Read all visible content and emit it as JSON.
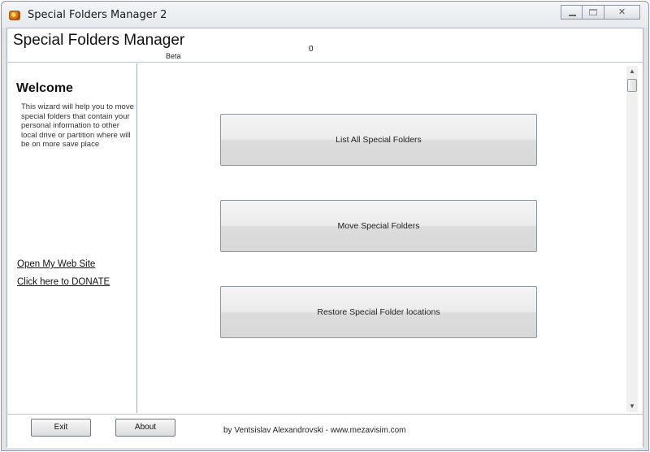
{
  "window": {
    "title": "Special Folders Manager 2",
    "controls": {
      "minimize": "minimize",
      "maximize": "maximize",
      "close": "✕"
    }
  },
  "header": {
    "title": "Special Folders Manager",
    "beta": "Beta",
    "counter": "0"
  },
  "sidebar": {
    "welcome": "Welcome",
    "intro": "This wizard will help you to move special folders that contain your personal information to other local drive or partition where will be on more save place",
    "link_website": "Open My Web Site",
    "link_donate": "Click here to DONATE"
  },
  "main": {
    "buttons": [
      {
        "label": "List All Special Folders"
      },
      {
        "label": "Move Special Folders"
      },
      {
        "label": "Restore Special Folder locations"
      }
    ]
  },
  "footer": {
    "exit_label": "Exit",
    "about_label": "About",
    "credit": "by Ventsislav Alexandrovski - www.mezavisim.com"
  },
  "icons": {
    "app": "app-icon",
    "scroll_up": "chevron-up-icon",
    "scroll_down": "chevron-down-icon"
  }
}
